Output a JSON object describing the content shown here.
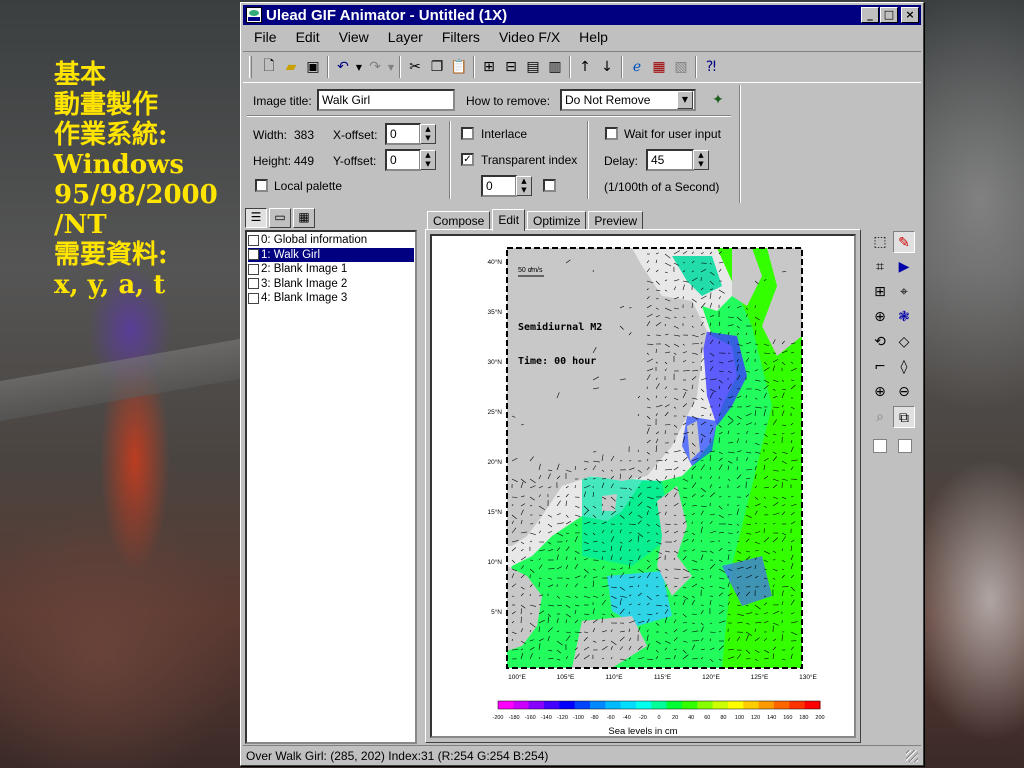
{
  "slide": {
    "lines": [
      "基本",
      "動畫製作",
      "作業系統:",
      "Windows",
      "95/98/2000",
      "/NT",
      "需要資料:",
      "x, y, a, t"
    ]
  },
  "window": {
    "title": "Ulead GIF Animator - Untitled (1X)",
    "buttons": {
      "minimize": "_",
      "maximize": "□",
      "close": "×"
    }
  },
  "menu": [
    "File",
    "Edit",
    "View",
    "Layer",
    "Filters",
    "Video F/X",
    "Help"
  ],
  "toolbar": {
    "icons": [
      "new-file-icon",
      "open-folder-icon",
      "save-icon",
      "undo-icon",
      "redo-icon",
      "cut-icon",
      "copy-icon",
      "paste-icon",
      "add-image-icon",
      "add-video-icon",
      "insert-frame-icon",
      "delete-frame-icon",
      "move-up-icon",
      "move-down-icon",
      "preview-browser-icon",
      "optimize-icon",
      "wizard-icon",
      "help-icon"
    ]
  },
  "props": {
    "image_title_label": "Image title:",
    "image_title_value": "Walk Girl",
    "how_to_remove_label": "How to remove:",
    "how_to_remove_value": "Do Not Remove",
    "width_label": "Width:",
    "width_value": "383",
    "height_label": "Height:",
    "height_value": "449",
    "x_offset_label": "X-offset:",
    "x_offset_value": "0",
    "y_offset_label": "Y-offset:",
    "y_offset_value": "0",
    "local_palette_label": "Local palette",
    "interlace_label": "Interlace",
    "transparent_index_label": "Transparent index",
    "transparent_index_value": "0",
    "wait_label": "Wait for user input",
    "delay_label": "Delay:",
    "delay_value": "45",
    "delay_unit": "(1/100th of a Second)"
  },
  "frames": [
    {
      "label": "0: Global information",
      "selected": false
    },
    {
      "label": "1: Walk Girl",
      "selected": true
    },
    {
      "label": "2: Blank Image 1",
      "selected": false
    },
    {
      "label": "3: Blank Image 2",
      "selected": false
    },
    {
      "label": "4: Blank Image 3",
      "selected": false
    }
  ],
  "tabs": [
    {
      "label": "Compose",
      "active": false
    },
    {
      "label": "Edit",
      "active": true
    },
    {
      "label": "Optimize",
      "active": false
    },
    {
      "label": "Preview",
      "active": false
    }
  ],
  "map": {
    "scale_label": "50 cm/s",
    "title": "Semidiurnal M2",
    "time_label": "Time: 00 hour",
    "lat_labels": [
      "40°N",
      "35°N",
      "30°N",
      "25°N",
      "20°N",
      "15°N",
      "10°N",
      "5°N"
    ],
    "lon_labels": [
      "100°E",
      "105°E",
      "110°E",
      "115°E",
      "120°E",
      "125°E",
      "130°E"
    ],
    "colorbar_ticks": [
      "-200",
      "-180",
      "-160",
      "-140",
      "-120",
      "-100",
      "-80",
      "-60",
      "-40",
      "-20",
      "0",
      "20",
      "40",
      "60",
      "80",
      "100",
      "120",
      "140",
      "160",
      "180",
      "200"
    ],
    "colorbar_label": "Sea levels in cm",
    "colors": [
      "#ff00ff",
      "#cc00ff",
      "#8800ff",
      "#4400ff",
      "#0000ff",
      "#0044ff",
      "#0088ff",
      "#00bbff",
      "#00ddff",
      "#00ffee",
      "#00ff99",
      "#00ff33",
      "#33ff00",
      "#88ff00",
      "#ccff00",
      "#ffff00",
      "#ffcc00",
      "#ff9900",
      "#ff6600",
      "#ff3300",
      "#ff0000"
    ]
  },
  "status": "Over Walk Girl: (285, 202)  Index:31 (R:254 G:254 B:254)"
}
